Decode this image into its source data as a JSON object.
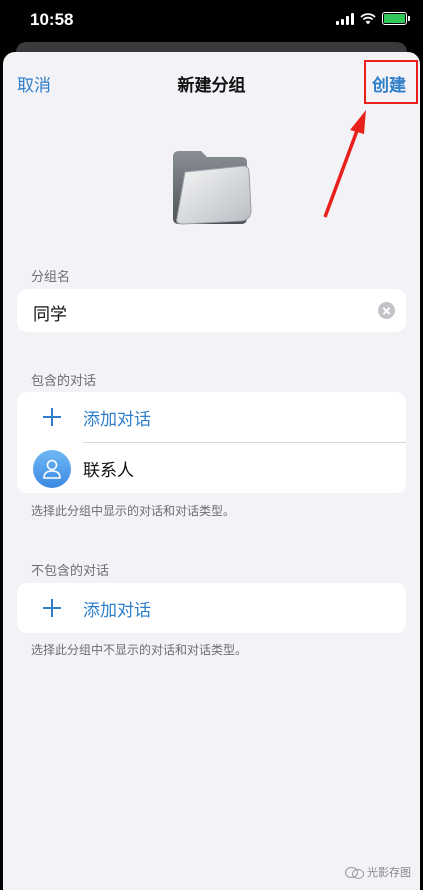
{
  "status_bar": {
    "time": "10:58",
    "icons": [
      "signal-icon",
      "wifi-icon",
      "battery-charging-icon"
    ]
  },
  "nav": {
    "cancel_label": "取消",
    "title": "新建分组",
    "create_label": "创建"
  },
  "folder_icon": "folder-icon",
  "group_name": {
    "section_label": "分组名",
    "value": "同学"
  },
  "included": {
    "section_label": "包含的对话",
    "add_label": "添加对话",
    "items": [
      {
        "label": "联系人",
        "icon": "person-icon"
      }
    ],
    "note": "选择此分组中显示的对话和对话类型。"
  },
  "excluded": {
    "section_label": "不包含的对话",
    "add_label": "添加对话",
    "note": "选择此分组中不显示的对话和对话类型。"
  },
  "watermark": {
    "text": "光影存图"
  },
  "colors": {
    "accent": "#2e7ec9",
    "annotation": "#e8201c",
    "background": "#f2f2f7"
  }
}
